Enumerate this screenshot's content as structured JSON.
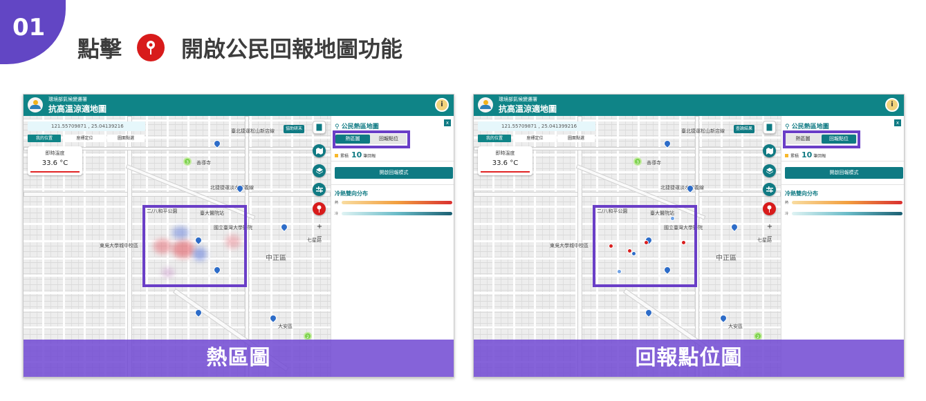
{
  "step": {
    "number": "01"
  },
  "headline": {
    "prefix": "點擊",
    "suffix": "開啟公民回報地圖功能",
    "icon": "location-pin-icon",
    "icon_color": "#d81b1b"
  },
  "brand": {
    "teal": "#0f8487",
    "purple": "#6246c4",
    "red": "#d81b1b"
  },
  "app": {
    "agency": "環境部氣候變遷署",
    "title": "抗高溫涼適地圖",
    "info_icon": "info-icon"
  },
  "panels": [
    {
      "coord": "121.55709871 , 25.04139216",
      "tabs": [
        "我的位置",
        "座標定位",
        "圖面點選"
      ],
      "temp_label": "即時溫度",
      "temp_value": "33.6 °C",
      "feedback_label": "協助研末",
      "sidebar_title": "公民熱區地圖",
      "toggle": [
        "熱區圖",
        "回報點位"
      ],
      "active_toggle": 0,
      "count_prefix": "累積",
      "count_value": "10",
      "count_suffix": "筆回報",
      "mode_button": "開啟回報模式",
      "trend_title": "冷熱雙向分布",
      "legend_hot": "熱",
      "legend_cold": "冷",
      "banner": "熱區圖",
      "zoom_in": "+",
      "zoom_out": "−",
      "close": "x"
    },
    {
      "coord": "121.55709871 , 25.041399216",
      "tabs": [
        "我的位置",
        "座標定位",
        "圖面點選"
      ],
      "temp_label": "即時溫度",
      "temp_value": "33.6 °C",
      "feedback_label": "查論結果",
      "sidebar_title": "公民熱區地圖",
      "toggle": [
        "熱區圖",
        "回報點位"
      ],
      "active_toggle": 1,
      "count_prefix": "累積",
      "count_value": "10",
      "count_suffix": "筆回報",
      "mode_button": "開啟回報模式",
      "trend_title": "冷熱雙向分布",
      "legend_hot": "熱",
      "legend_cold": "冷",
      "banner": "回報點位圖",
      "zoom_in": "+",
      "zoom_out": "−",
      "close": "x"
    }
  ],
  "map_labels": [
    "臺北捷運松山新店線",
    "中正區",
    "七星路",
    "大安區",
    "二/八和平公園",
    "國立臺灣大學醫院",
    "臺大醫院站",
    "北捷捷運淡水信義線",
    "善導寺",
    "東吳大學城中校區"
  ]
}
